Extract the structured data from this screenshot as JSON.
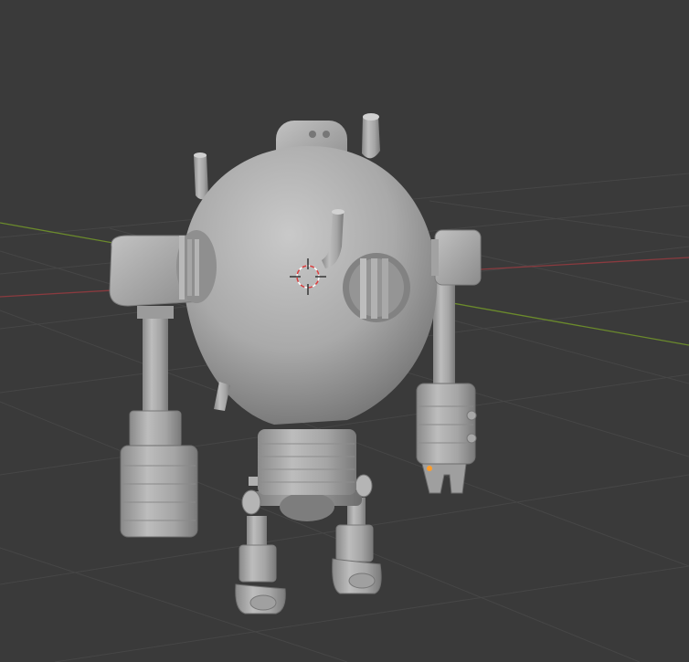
{
  "viewport": {
    "background": "#3a3a3a",
    "grid_color": "#4a4a4a",
    "x_axis_color": "#8a3a3f",
    "y_axis_color": "#6b8a2c"
  },
  "model": {
    "kind": "robot-mesh",
    "shading": "solid-gray",
    "base_color": "#a8a8a8",
    "highlight_color": "#cfcfcf",
    "shadow_color": "#6a6a6a"
  },
  "overlays": {
    "cursor_3d_icon": "3d-cursor-icon",
    "origin_marker_color": "#ff9d2a"
  }
}
